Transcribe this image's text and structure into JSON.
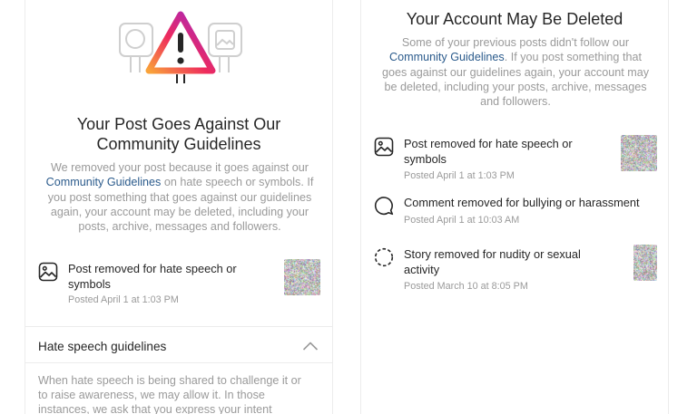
{
  "left_panel": {
    "title_line1": "Your Post Goes Against Our",
    "title_line2": "Community Guidelines",
    "desc_line1": "We removed your post because it goes against our",
    "desc_link": "Community Guidelines",
    "desc_line2_rest": " on hate speech or symbols. If",
    "desc_line3": "you post something that goes against our guidelines",
    "desc_line4": "again, your account may be deleted, including your",
    "desc_line5": "posts, archive, messages and followers.",
    "item": {
      "icon": "image-icon",
      "title_line1": "Post removed for hate speech or",
      "title_line2": "symbols",
      "timestamp": "Posted April 1 at 1:03 PM"
    },
    "section": {
      "title": "Hate speech guidelines",
      "chevron": "chevron-up-icon",
      "text_line1": "When hate speech is being shared to challenge it or",
      "text_line2": "to raise awareness, we may allow it. In those",
      "text_line3": "instances, we ask that you express your intent"
    }
  },
  "right_panel": {
    "title": "Your Account May Be Deleted",
    "desc_line1": "Some of your previous posts didn't follow our",
    "desc_link": "Community Guidelines",
    "desc_line2_rest": ". If you post something that",
    "desc_line3": "goes against our guidelines again, your account may",
    "desc_line4": "be deleted, including your posts, archive, messages",
    "desc_line5": "and followers.",
    "items": [
      {
        "icon": "image-icon",
        "title_line1": "Post removed for hate speech or",
        "title_line2": "symbols",
        "timestamp": "Posted April 1 at 1:03 PM"
      },
      {
        "icon": "comment-icon",
        "title_line1": "Comment removed for bullying or harassment",
        "title_line2": "",
        "timestamp": "Posted April 1 at 10:03 AM"
      },
      {
        "icon": "story-icon",
        "title_line1": "Story removed for nudity or sexual",
        "title_line2": "activity",
        "timestamp": "Posted March 10 at 8:05 PM"
      }
    ]
  },
  "colors": {
    "link": "#2b5b8c",
    "muted_text": "#9a9a9a",
    "text": "#262626",
    "warning_gradient": [
      "#f9a23a",
      "#ee2a5d",
      "#c2279a",
      "#7a3ad0"
    ]
  }
}
